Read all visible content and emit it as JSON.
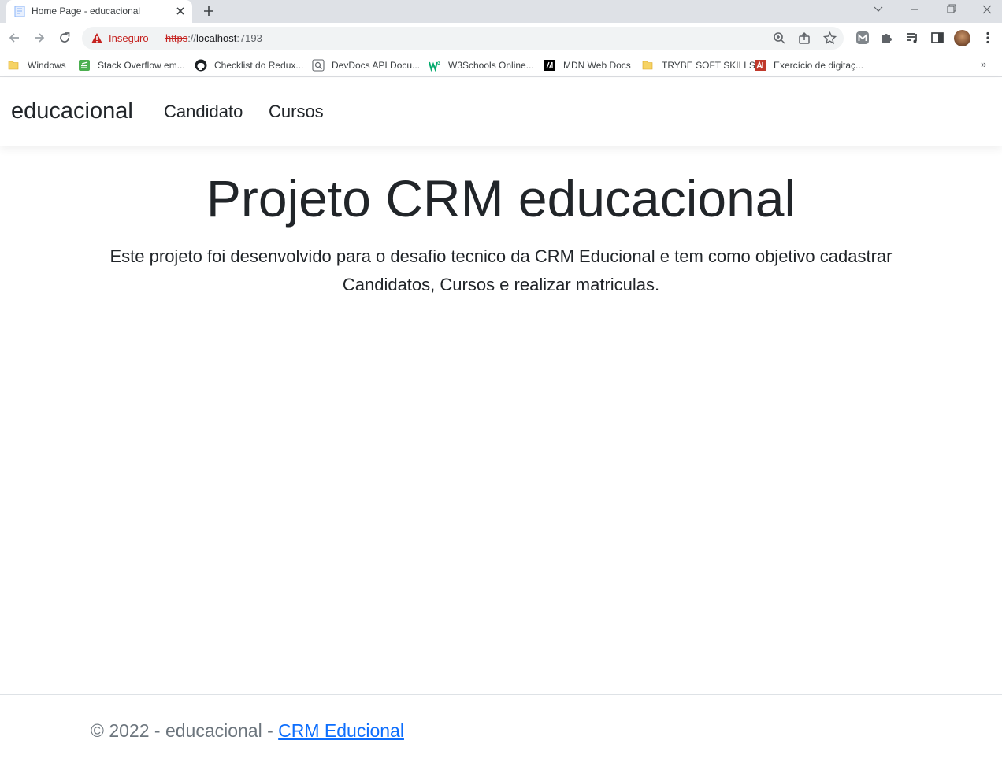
{
  "browser": {
    "tab_title": "Home Page - educacional",
    "security_label": "Inseguro",
    "url_scheme": "https",
    "url_sep": "://",
    "url_host": "localhost",
    "url_port": ":7193",
    "bookmarks": [
      {
        "label": "Windows",
        "icon": "folder-icon"
      },
      {
        "label": "Stack Overflow em...",
        "icon": "stackoverflow-icon"
      },
      {
        "label": "Checklist do Redux...",
        "icon": "github-icon"
      },
      {
        "label": "DevDocs API Docu...",
        "icon": "devdocs-icon"
      },
      {
        "label": "W3Schools Online...",
        "icon": "w3schools-icon"
      },
      {
        "label": "MDN Web Docs",
        "icon": "mdn-icon"
      },
      {
        "label": "TRYBE SOFT SKILLS",
        "icon": "folder-icon"
      },
      {
        "label": "Exercício de digitaç...",
        "icon": "typing-icon"
      }
    ],
    "more_bookmarks": "»"
  },
  "navbar": {
    "brand": "educacional",
    "links": [
      "Candidato",
      "Cursos"
    ]
  },
  "hero": {
    "title": "Projeto CRM educacional",
    "text": "Este projeto foi desenvolvido para o desafio tecnico da CRM Educional e tem como objetivo cadastrar Candidatos, Cursos e realizar matriculas."
  },
  "footer": {
    "text": "© 2022 - educacional - ",
    "link": "CRM Educional"
  },
  "colors": {
    "insecure_red": "#c5221f",
    "link_blue": "#0d6efd",
    "footer_gray": "#6c757d"
  }
}
